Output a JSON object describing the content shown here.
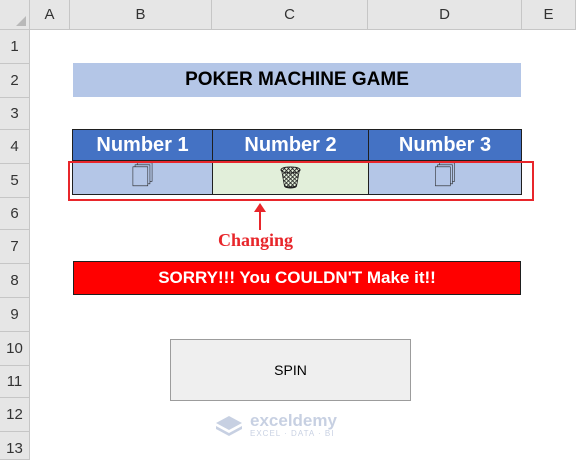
{
  "columns": [
    "A",
    "B",
    "C",
    "D",
    "E"
  ],
  "rows": [
    "1",
    "2",
    "3",
    "4",
    "5",
    "6",
    "7",
    "8",
    "9",
    "10",
    "11",
    "12",
    "13"
  ],
  "game": {
    "title": "POKER MACHINE GAME",
    "headers": [
      "Number 1",
      "Number 2",
      "Number 3"
    ],
    "values": [
      "🗍",
      "🗑",
      "🗍"
    ],
    "annotation": "Changing",
    "result": "SORRY!!! You COULDN'T Make it!!",
    "spin_label": "SPIN"
  },
  "watermark": {
    "name": "exceldemy",
    "tagline": "EXCEL · DATA · BI"
  },
  "colors": {
    "title_bg": "#b4c6e7",
    "header_bg": "#4472c4",
    "cell_blue": "#b4c6e7",
    "cell_green": "#e2efda",
    "result_bg": "#ff0000",
    "annotation": "#e8262b"
  }
}
